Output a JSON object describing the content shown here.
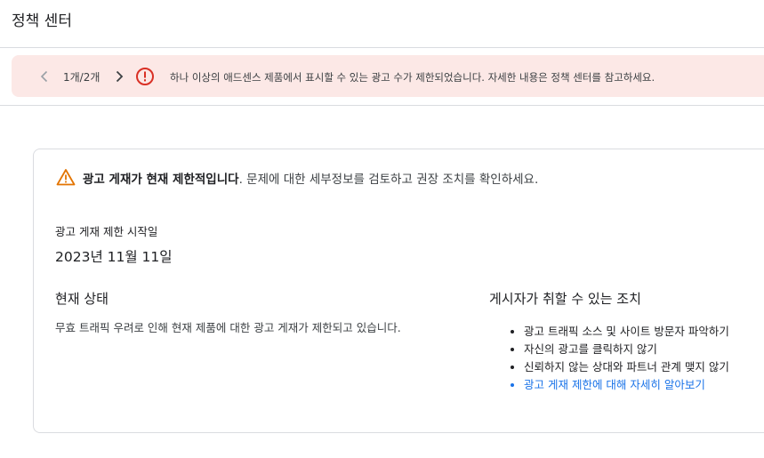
{
  "header": {
    "title": "정책 센터"
  },
  "alert": {
    "pager_text": "1개/2개",
    "message": "하나 이상의 애드센스 제품에서 표시할 수 있는 광고 수가 제한되었습니다. 자세한 내용은 정책 센터를 참고하세요.",
    "background_color": "#fce8e6",
    "icon_color": "#d93025"
  },
  "card": {
    "warning_bold": "광고 게재가 현재 제한적입니다",
    "warning_rest": ". 문제에 대한 세부정보를 검토하고 권장 조치를 확인하세요.",
    "warning_icon_color": "#e37400",
    "start_label": "광고 게재 제한 시작일",
    "start_date": "2023년 11월 11일",
    "status_heading": "현재 상태",
    "status_text": "무효 트래픽 우려로 인해 현재 제품에 대한 광고 게재가 제한되고 있습니다.",
    "actions_heading": "게시자가 취할 수 있는 조치",
    "actions": [
      "광고 트래픽 소스 및 사이트 방문자 파악하기",
      "자신의 광고를 클릭하지 않기",
      "신뢰하지 않는 상대와 파트너 관계 맺지 않기",
      "광고 게재 제한에 대해 자세히 알아보기"
    ],
    "link_color": "#1a73e8"
  }
}
